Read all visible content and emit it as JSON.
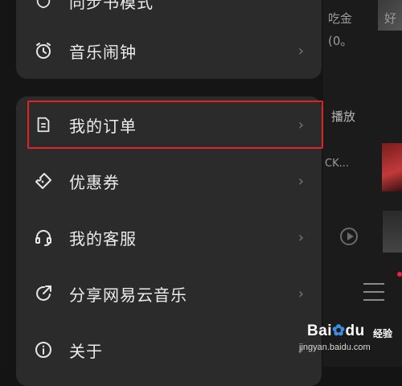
{
  "drawer": {
    "top_card": {
      "partial_item": {
        "label": "同步书模式"
      },
      "alarm": {
        "label": "音乐闹钟"
      }
    },
    "menu": [
      {
        "label": "我的订单",
        "icon": "document-icon"
      },
      {
        "label": "优惠券",
        "icon": "coupon-icon"
      },
      {
        "label": "我的客服",
        "icon": "headset-icon"
      },
      {
        "label": "分享网易云音乐",
        "icon": "share-icon"
      },
      {
        "label": "关于",
        "icon": "info-icon"
      }
    ],
    "chevron": "›"
  },
  "background": {
    "text1": "吃金",
    "text2": "好",
    "text3": "(0。",
    "text4": "播放",
    "text5": "CK..."
  },
  "watermark": {
    "logo": "Bai",
    "logo2": "du",
    "tag": "经验",
    "url": "jingyan.baidu.com"
  },
  "colors": {
    "highlight": "#e02424",
    "card": "#2b2b2b",
    "background": "#141414"
  }
}
